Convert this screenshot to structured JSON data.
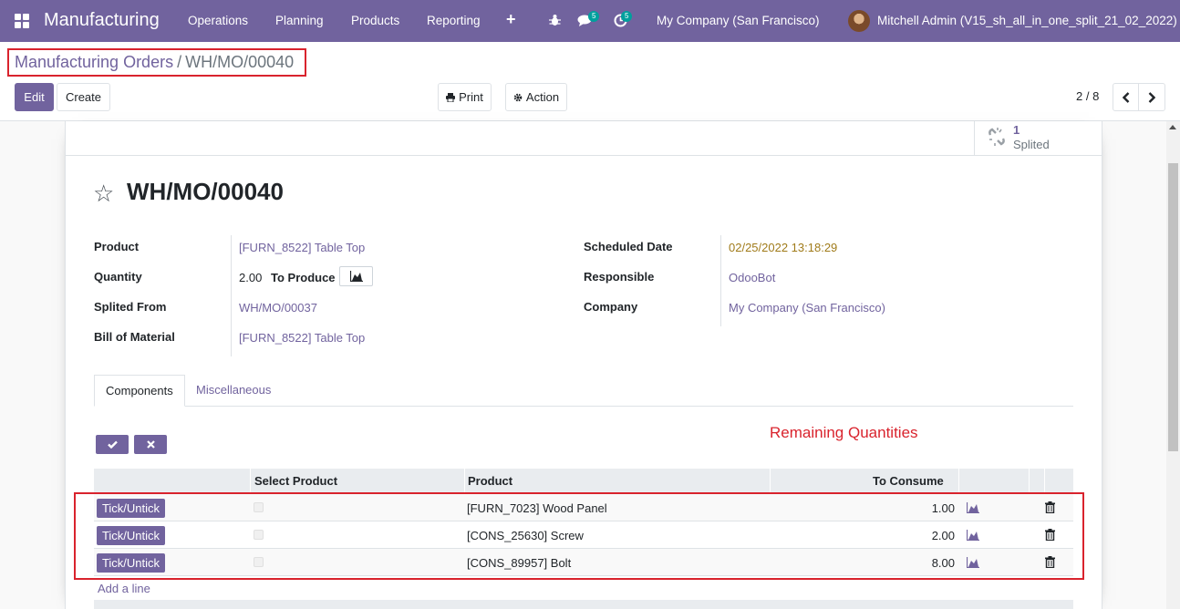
{
  "navbar": {
    "brand": "Manufacturing",
    "menu": [
      "Operations",
      "Planning",
      "Products",
      "Reporting"
    ],
    "messages_count": "5",
    "activities_count": "5",
    "company": "My Company (San Francisco)",
    "user": "Mitchell Admin (V15_sh_all_in_one_split_21_02_2022)"
  },
  "breadcrumb": {
    "parent": "Manufacturing Orders",
    "separator": "/",
    "current": "WH/MO/00040"
  },
  "toolbar": {
    "edit_label": "Edit",
    "create_label": "Create",
    "print_label": "Print",
    "action_label": "Action",
    "pager": "2 / 8"
  },
  "smart_button": {
    "count": "1",
    "label": "Splited"
  },
  "record": {
    "title": "WH/MO/00040",
    "fields_left": [
      {
        "label": "Product",
        "value": "[FURN_8522] Table Top"
      },
      {
        "label": "Quantity",
        "value": "2.00",
        "extra": "To Produce"
      },
      {
        "label": "Splited From",
        "value": "WH/MO/00037"
      },
      {
        "label": "Bill of Material",
        "value": "[FURN_8522] Table Top"
      }
    ],
    "fields_right": [
      {
        "label": "Scheduled Date",
        "value": "02/25/2022 13:18:29"
      },
      {
        "label": "Responsible",
        "value": "OdooBot"
      },
      {
        "label": "Company",
        "value": "My Company (San Francisco)"
      }
    ]
  },
  "tabs": [
    "Components",
    "Miscellaneous"
  ],
  "annotation": "Remaining Quantities",
  "table": {
    "headers": {
      "select": "Select Product",
      "product": "Product",
      "to_consume": "To Consume"
    },
    "tick_label": "Tick/Untick",
    "rows": [
      {
        "product": "[FURN_7023] Wood Panel",
        "qty": "1.00"
      },
      {
        "product": "[CONS_25630] Screw",
        "qty": "2.00"
      },
      {
        "product": "[CONS_89957] Bolt",
        "qty": "8.00"
      }
    ],
    "add_line": "Add a line"
  },
  "colors": {
    "brand": "#71639e",
    "highlight": "#d9232d",
    "date": "#a07b1a"
  }
}
